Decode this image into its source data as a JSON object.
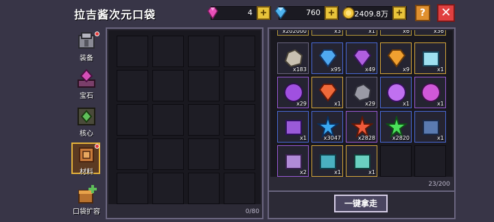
{
  "header": {
    "title": "拉吉酱次元口袋",
    "currencies": [
      {
        "name": "gems",
        "icon": "pink-gem-icon",
        "value": "4"
      },
      {
        "name": "diamonds",
        "icon": "blue-diamond-icon",
        "value": "760"
      },
      {
        "name": "gold",
        "icon": "gold-coin-icon",
        "value": "2409.8万"
      }
    ],
    "help_label": "?",
    "close_label": "✕",
    "plus_label": "+"
  },
  "sidebar": {
    "items": [
      {
        "label": "装备",
        "icon": "armor-icon",
        "badge": true,
        "active": false
      },
      {
        "label": "宝石",
        "icon": "gem-shrine-icon",
        "badge": false,
        "active": false
      },
      {
        "label": "核心",
        "icon": "core-icon",
        "badge": false,
        "active": false
      },
      {
        "label": "材料",
        "icon": "material-crate-icon",
        "badge": true,
        "active": true
      },
      {
        "label": "口袋扩容",
        "icon": "pocket-expand-icon",
        "badge": false,
        "active": false
      }
    ]
  },
  "left_panel": {
    "count": "0/80"
  },
  "right_panel": {
    "count": "23/200",
    "top_partial_row": [
      "x202000",
      "x3",
      "x1",
      "x6",
      "x36"
    ],
    "items": [
      {
        "icon": "stone-ore-icon",
        "qty": "x183"
      },
      {
        "icon": "blue-crystal-icon",
        "qty": "x95"
      },
      {
        "icon": "purple-crystal-icon",
        "qty": "x49"
      },
      {
        "icon": "amber-gem-icon",
        "qty": "x9"
      },
      {
        "icon": "frost-rune-icon",
        "qty": "x1"
      },
      {
        "icon": "purple-potion-icon",
        "qty": "x29"
      },
      {
        "icon": "fire-crystal-icon",
        "qty": "x1"
      },
      {
        "icon": "iron-ore-icon",
        "qty": "x29"
      },
      {
        "icon": "magic-orb-icon",
        "qty": "x1"
      },
      {
        "icon": "violet-flask-icon",
        "qty": "x1"
      },
      {
        "icon": "purple-chest-icon",
        "qty": "x1"
      },
      {
        "icon": "blue-star-shard-icon",
        "qty": "x3047"
      },
      {
        "icon": "red-star-shard-icon",
        "qty": "x2828"
      },
      {
        "icon": "green-star-shard-icon",
        "qty": "x2820"
      },
      {
        "icon": "blue-cube-icon",
        "qty": "x1"
      },
      {
        "icon": "sword-scroll-icon",
        "qty": "x2"
      },
      {
        "icon": "cat-token-icon",
        "qty": "x1"
      },
      {
        "icon": "robot-token-icon",
        "qty": "x1"
      }
    ]
  },
  "actions": {
    "collect_all_label": "一键拿走"
  },
  "colors": {
    "background": "#383547",
    "panel": "#19181f",
    "accent_gold": "#e7b43a",
    "close_red": "#e04040"
  }
}
